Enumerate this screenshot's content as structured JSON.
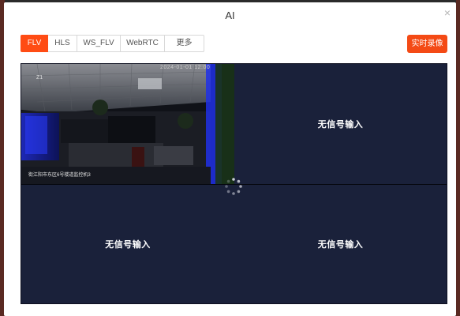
{
  "dialog": {
    "title": "AI",
    "close_glyph": "×"
  },
  "protocol_tabs": [
    {
      "label": "FLV",
      "active": true
    },
    {
      "label": "HLS",
      "active": false
    },
    {
      "label": "WS_FLV",
      "active": false
    },
    {
      "label": "WebRTC",
      "active": false
    },
    {
      "label": "更多",
      "active": false
    }
  ],
  "record_button": {
    "label": "实时录像"
  },
  "video_grid": {
    "cells": [
      {
        "type": "camera",
        "channel": "Z1",
        "timestamp": "2024-01-01 12:00",
        "caption": "街江阳市东区6号楼道监控机3"
      },
      {
        "type": "empty",
        "label": "无信号输入"
      },
      {
        "type": "empty",
        "label": "无信号输入"
      },
      {
        "type": "empty",
        "label": "无信号输入"
      }
    ],
    "loading": true
  },
  "colors": {
    "accent": "#ff4c14",
    "grid_bg": "#1a213a"
  }
}
